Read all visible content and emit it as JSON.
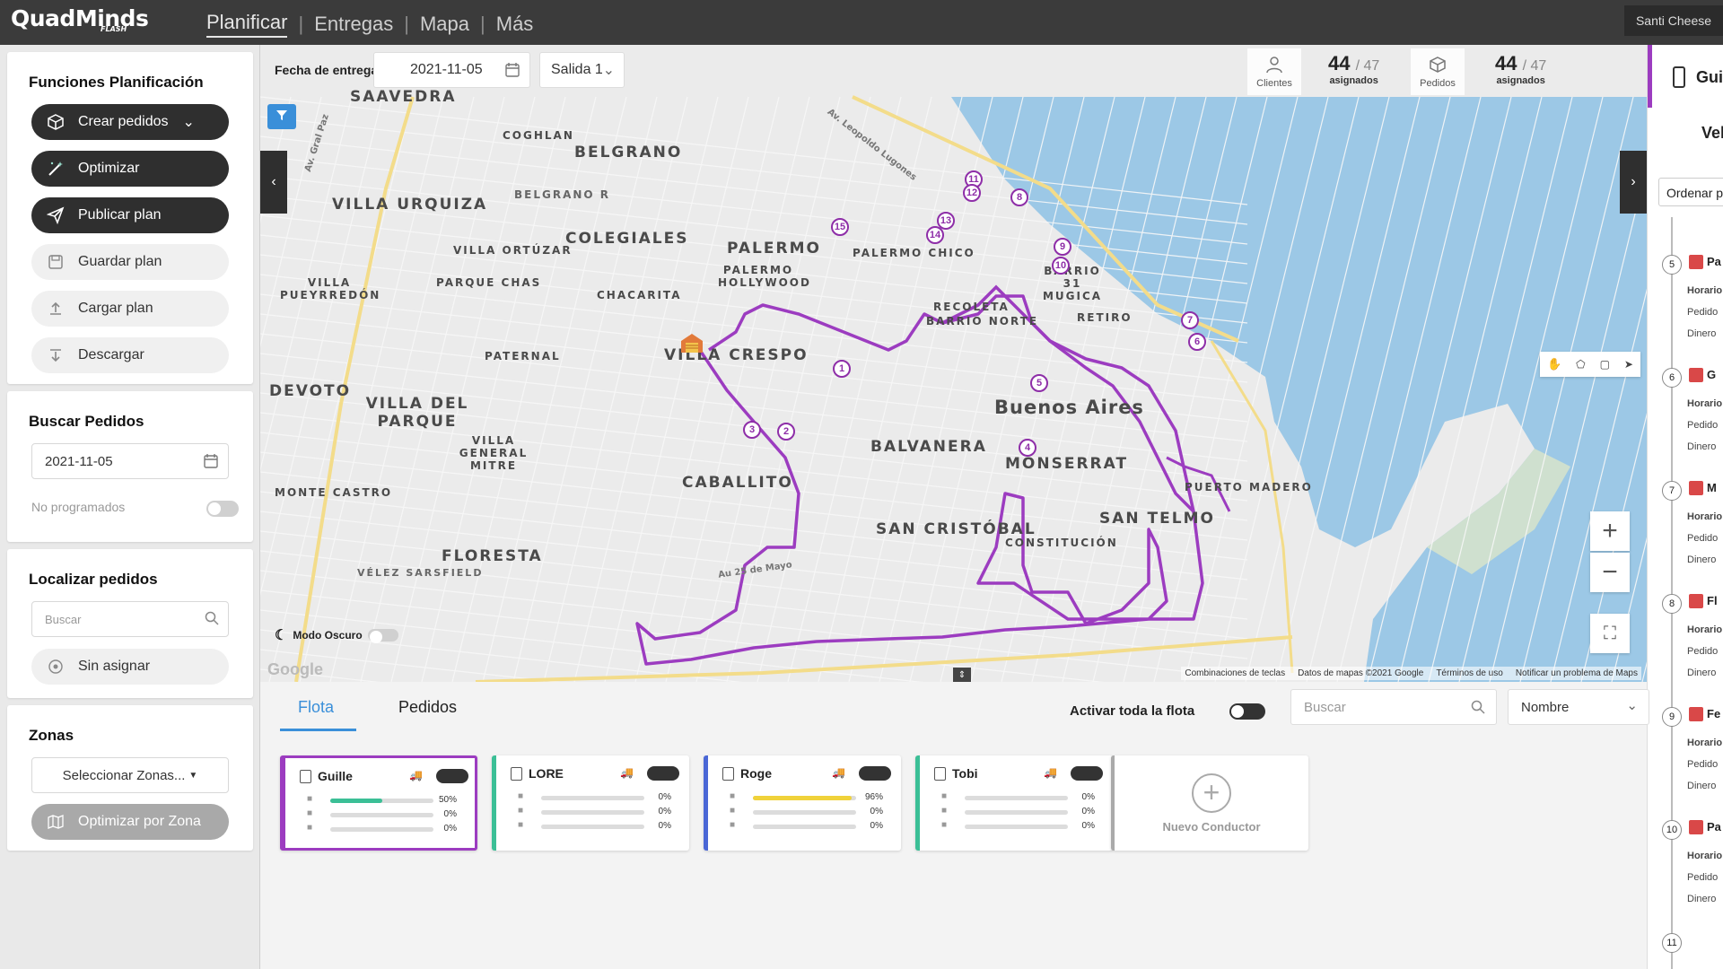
{
  "app": {
    "logo": "QuadMinds",
    "logo_sub": "FLASH",
    "user": "Santi Cheese"
  },
  "nav": {
    "items": [
      "Planificar",
      "Entregas",
      "Mapa",
      "Más"
    ],
    "active": "Planificar"
  },
  "planning": {
    "title": "Funciones Planificación",
    "buttons": {
      "crear": "Crear pedidos",
      "optimizar": "Optimizar",
      "publicar": "Publicar plan",
      "guardar": "Guardar plan",
      "cargar": "Cargar plan",
      "descargar": "Descargar"
    }
  },
  "buscar": {
    "title": "Buscar Pedidos",
    "date": "2021-11-05",
    "no_programados": "No programados"
  },
  "localizar": {
    "title": "Localizar pedidos",
    "placeholder": "Buscar",
    "sin_asignar": "Sin asignar"
  },
  "zonas": {
    "title": "Zonas",
    "select": "Seleccionar Zonas...",
    "optimizar": "Optimizar por Zona"
  },
  "mapheader": {
    "fecha_label": "Fecha de entrega",
    "fecha": "2021-11-05",
    "salida": "Salida 1",
    "clientes_label": "Clientes",
    "clientes_num": "44",
    "clientes_total": "/ 47",
    "clientes_sub": "asignados",
    "pedidos_label": "Pedidos",
    "pedidos_num": "44",
    "pedidos_total": "/ 47",
    "pedidos_sub": "asignados"
  },
  "map": {
    "route_color": "#9c3cc0",
    "labels": {
      "saavedra": "SAAVEDRA",
      "coghlan": "COGHLAN",
      "belgrano": "BELGRANO",
      "belgrano_r": "BELGRANO R",
      "villa_urquiza": "VILLA URQUIZA",
      "colegiales": "COLEGIALES",
      "palermo": "PALERMO",
      "palermo_hollywood": "PALERMO HOLLYWOOD",
      "palermo_chico": "PALERMO CHICO",
      "villa_ortuzar": "VILLA ORTÚZAR",
      "villa_pueyrredon": "VILLA PUEYRREDÓN",
      "parque_chas": "PARQUE CHAS",
      "chacarita": "CHACARITA",
      "barrio_31": "BARRIO 31 MUGICA",
      "recoleta": "RECOLETA",
      "barrio_norte": "BARRIO NORTE",
      "retiro": "RETIRO",
      "villa_crespo": "VILLA CRESPO",
      "paternal": "PATERNAL",
      "devoto": "DEVOTO",
      "villa_del_parque": "VILLA DEL PARQUE",
      "buenos_aires": "Buenos Aires",
      "balvanera": "BALVANERA",
      "villa_general_mitre": "VILLA GENERAL MITRE",
      "monserrat": "MONSERRAT",
      "caballito": "CABALLITO",
      "puerto_madero": "PUERTO MADERO",
      "monte_castro": "MONTE CASTRO",
      "san_telmo": "SAN TELMO",
      "san_cristobal": "SAN CRISTÓBAL",
      "constitucion": "CONSTITUCIÓN",
      "floresta": "FLORESTA",
      "velez": "VÉLEZ SARSFIELD",
      "av_leopoldo_lugones": "Av. Leopoldo Lugones",
      "av_gral_paz": "Av. Gral Paz",
      "av_25_mayo": "Au 25 de Mayo"
    },
    "stops": [
      "1",
      "2",
      "3",
      "4",
      "5",
      "6",
      "7",
      "8",
      "9",
      "10",
      "11",
      "12",
      "13",
      "14",
      "15"
    ],
    "dark_mode_label": "Modo Oscuro",
    "attribution": [
      "Combinaciones de teclas",
      "Datos de mapas ©2021 Google",
      "Términos de uso",
      "Notificar un problema de Maps"
    ],
    "google": "Google"
  },
  "bottom": {
    "tabs": [
      "Flota",
      "Pedidos"
    ],
    "activar": "Activar toda la flota",
    "search_placeholder": "Buscar",
    "sort": "Nombre",
    "drivers": [
      {
        "name": "Guille",
        "accent": "#9c3cc0",
        "bar1": 50,
        "bar2": 0,
        "bar3": 0,
        "p1": "50%",
        "p2": "0%",
        "p3": "0%",
        "fillcolor": "#3bbf96"
      },
      {
        "name": "LORE",
        "accent": "#3bbf96",
        "bar1": 0,
        "bar2": 0,
        "bar3": 0,
        "p1": "0%",
        "p2": "0%",
        "p3": "0%",
        "fillcolor": "#3bbf96"
      },
      {
        "name": "Roge",
        "accent": "#4a67d6",
        "bar1": 96,
        "bar2": 0,
        "bar3": 0,
        "p1": "96%",
        "p2": "0%",
        "p3": "0%",
        "fillcolor": "#f0d23a"
      },
      {
        "name": "Tobi",
        "accent": "#3bbf96",
        "bar1": 0,
        "bar2": 0,
        "bar3": 0,
        "p1": "0%",
        "p2": "0%",
        "p3": "0%",
        "fillcolor": "#3bbf96"
      }
    ],
    "nuevo": "Nuevo Conductor"
  },
  "rightpanel": {
    "title": "Gui",
    "veh": "Veh",
    "ordenar": "Ordenar por",
    "rows": [
      "Pedido",
      "Dinero",
      "Horario"
    ],
    "markers": [
      "5",
      "6",
      "7",
      "8",
      "9",
      "10",
      "11"
    ],
    "letters": [
      "Pa",
      "G",
      "M",
      "Fl",
      "Fe",
      "Pa"
    ]
  }
}
